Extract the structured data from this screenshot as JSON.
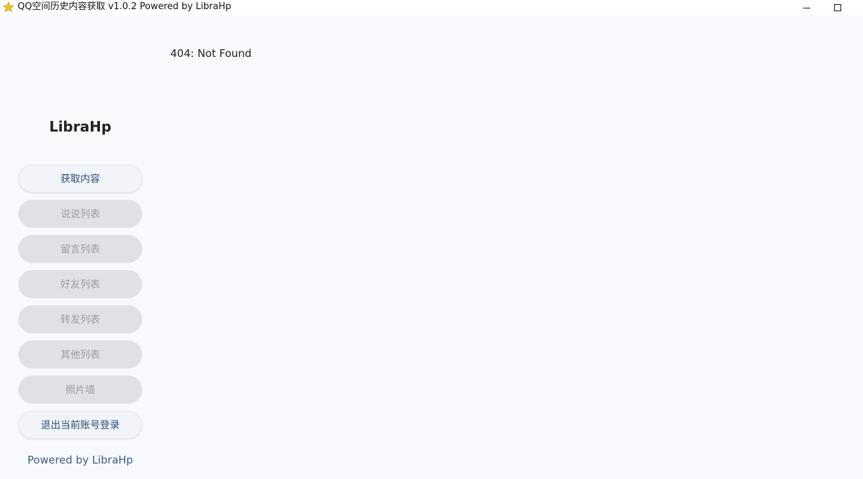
{
  "window": {
    "title": "QQ空间历史内容获取 v1.0.2 Powered by LibraHp",
    "icon": "star-icon",
    "icon_color": "#f5c518"
  },
  "sidebar": {
    "brand": "LibraHp",
    "items": [
      {
        "label": "获取内容",
        "enabled": true
      },
      {
        "label": "说说列表",
        "enabled": false
      },
      {
        "label": "留言列表",
        "enabled": false
      },
      {
        "label": "好友列表",
        "enabled": false
      },
      {
        "label": "转发列表",
        "enabled": false
      },
      {
        "label": "其他列表",
        "enabled": false
      },
      {
        "label": "照片墙",
        "enabled": false
      },
      {
        "label": "退出当前账号登录",
        "enabled": true
      }
    ],
    "footer": "Powered by LibraHp"
  },
  "main": {
    "message": "404: Not Found"
  },
  "colors": {
    "accent_text": "#2d4e74",
    "disabled_bg": "#e0e1e5",
    "disabled_text": "#9a9ca2",
    "background": "#f7f9fd"
  }
}
